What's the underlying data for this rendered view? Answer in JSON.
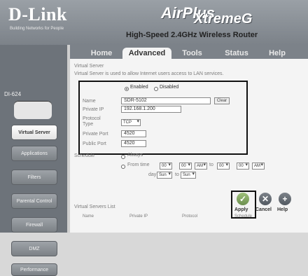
{
  "brand": {
    "name": "D-Link",
    "tagline": "Building Networks for People"
  },
  "product": {
    "line1": "AirPlus",
    "line2": "XtremeG",
    "subtitle": "High-Speed 2.4GHz Wireless Router"
  },
  "model": "DI-624",
  "nav": {
    "left": [
      {
        "label": "Virtual Server",
        "active": true
      },
      {
        "label": "Applications",
        "active": false
      },
      {
        "label": "Filters",
        "active": false
      },
      {
        "label": "Parental Control",
        "active": false
      },
      {
        "label": "Firewall",
        "active": false
      },
      {
        "label": "DMZ",
        "active": false
      },
      {
        "label": "Performance",
        "active": false
      }
    ],
    "tabs": [
      {
        "label": "Home",
        "active": false
      },
      {
        "label": "Advanced",
        "active": true
      },
      {
        "label": "Tools",
        "active": false
      },
      {
        "label": "Status",
        "active": false
      },
      {
        "label": "Help",
        "active": false
      }
    ]
  },
  "virtual_server": {
    "title": "Virtual Server",
    "description": "Virtual Server is used to allow Internet users access to LAN services.",
    "status_enabled": "Enabled",
    "status_disabled": "Disabled",
    "name_label": "Name",
    "name_value": "SDR-5102",
    "clear_label": "Clear",
    "private_ip_label": "Private IP",
    "private_ip_value": "192.168.1.200",
    "protocol_label": "Protocol Type",
    "protocol_value": "TCP",
    "private_port_label": "Private Port",
    "private_port_value": "4520",
    "public_port_label": "Public Port",
    "public_port_value": "4520",
    "schedule_label": "Schedule",
    "schedule_always": "Always",
    "schedule_from": "From time",
    "from_hour": "00",
    "from_min": "00",
    "from_ampm": "AM",
    "to_label": "to",
    "to_hour": "00",
    "to_min": "00",
    "to_ampm": "AM",
    "day_label": "day",
    "day_from": "Sun",
    "day_to": "Sun",
    "actions": {
      "apply": "Apply",
      "cancel": "Cancel",
      "help": "Help"
    },
    "list": {
      "title": "Virtual Servers List",
      "columns": [
        "Name",
        "Private IP",
        "Protocol",
        "Schedule"
      ]
    }
  }
}
